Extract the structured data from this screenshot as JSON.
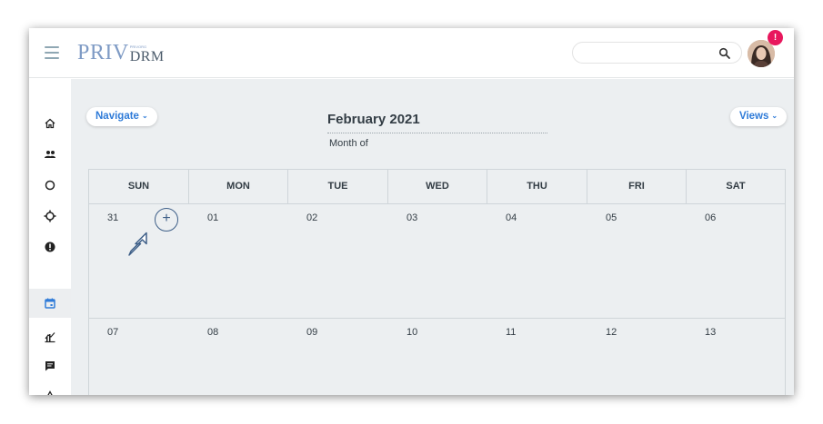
{
  "app": {
    "logo_main": "PRIV",
    "logo_small": "PRIVORG",
    "logo_sub": "DRM"
  },
  "header": {
    "search_placeholder": "",
    "notification_badge": "!"
  },
  "sidebar": {
    "items": [
      {
        "name": "home-icon",
        "active": false
      },
      {
        "name": "users-icon",
        "active": false
      },
      {
        "name": "circle-icon",
        "active": false
      },
      {
        "name": "target-icon",
        "active": false
      },
      {
        "name": "alert-circle-icon",
        "active": false
      },
      {
        "name": "calendar-icon",
        "active": true
      },
      {
        "name": "chart-icon",
        "active": false
      },
      {
        "name": "message-icon",
        "active": false
      },
      {
        "name": "warning-icon",
        "active": false
      }
    ]
  },
  "toolbar": {
    "navigate_label": "Navigate",
    "views_label": "Views",
    "chevron": "⌄"
  },
  "calendar": {
    "title": "February 2021",
    "subtitle": "Month of",
    "days_of_week": [
      "SUN",
      "MON",
      "TUE",
      "WED",
      "THU",
      "FRI",
      "SAT"
    ],
    "weeks": [
      [
        "31",
        "01",
        "02",
        "03",
        "04",
        "05",
        "06"
      ],
      [
        "07",
        "08",
        "09",
        "10",
        "11",
        "12",
        "13"
      ]
    ],
    "add_label": "+"
  },
  "colors": {
    "accent": "#2f7bd8",
    "badge": "#e8175d",
    "annotation": "#3e5f88",
    "background": "#eceff1"
  }
}
